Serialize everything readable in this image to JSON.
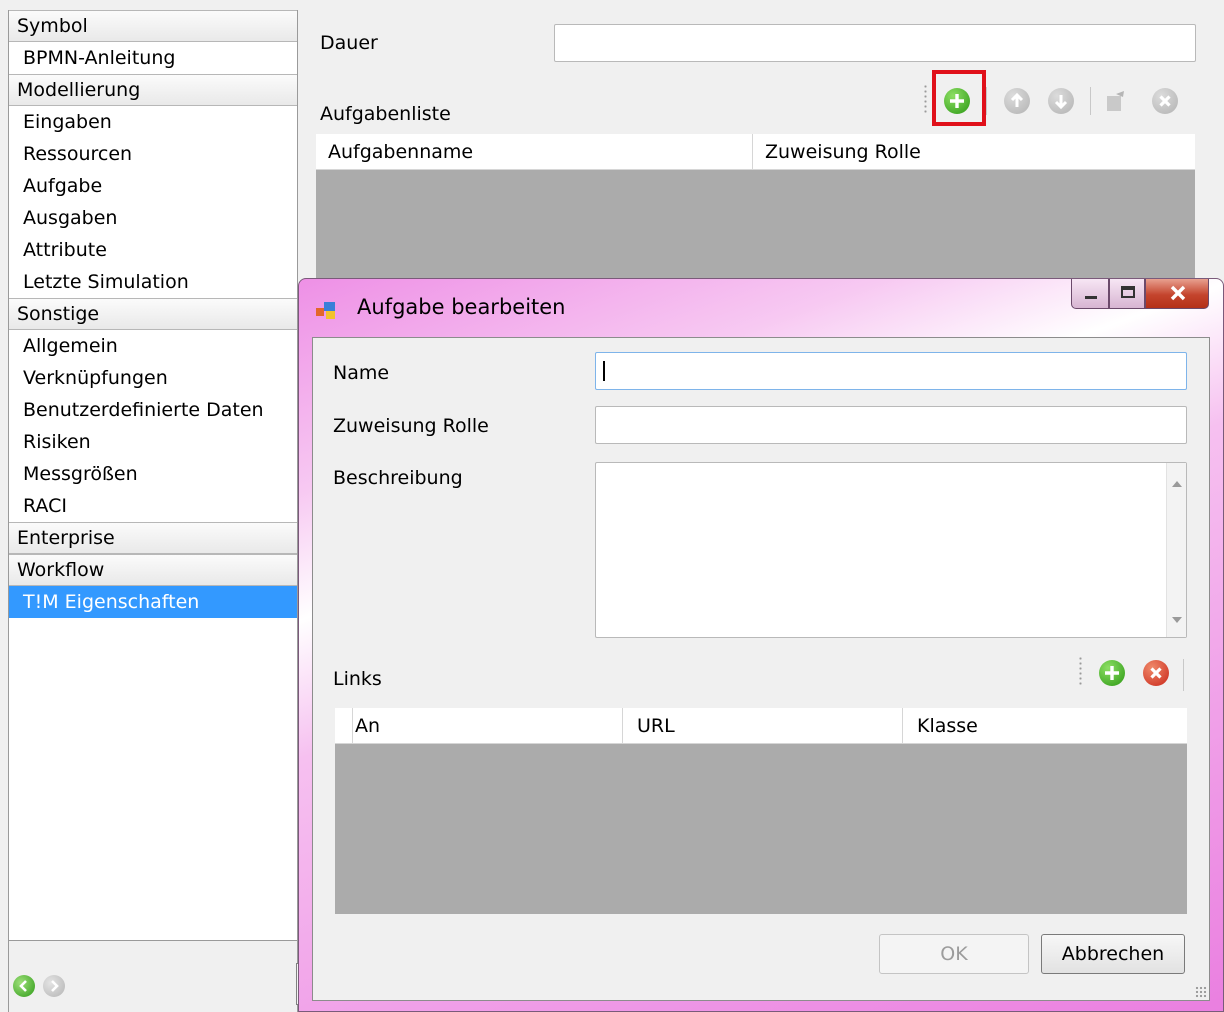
{
  "nav": {
    "items": [
      {
        "label": "Symbol",
        "type": "group"
      },
      {
        "label": "BPMN-Anleitung",
        "type": "item"
      },
      {
        "label": "Modellierung",
        "type": "group"
      },
      {
        "label": "Eingaben",
        "type": "item"
      },
      {
        "label": "Ressourcen",
        "type": "item"
      },
      {
        "label": "Aufgabe",
        "type": "item"
      },
      {
        "label": "Ausgaben",
        "type": "item"
      },
      {
        "label": "Attribute",
        "type": "item"
      },
      {
        "label": "Letzte Simulation",
        "type": "item"
      },
      {
        "label": "Sonstige",
        "type": "group"
      },
      {
        "label": "Allgemein",
        "type": "item"
      },
      {
        "label": "Verknüpfungen",
        "type": "item"
      },
      {
        "label": "Benutzerdefinierte Daten",
        "type": "item"
      },
      {
        "label": "Risiken",
        "type": "item"
      },
      {
        "label": "Messgrößen",
        "type": "item"
      },
      {
        "label": "RACI",
        "type": "item"
      },
      {
        "label": "Enterprise",
        "type": "group"
      },
      {
        "label": "Workflow",
        "type": "group"
      },
      {
        "label": "T!M Eigenschaften",
        "type": "item",
        "selected": true
      }
    ]
  },
  "props": {
    "duration_label": "Dauer",
    "duration_value": "",
    "tasklist_label": "Aufgabenliste",
    "columns": [
      "Aufgabenname",
      "Zuweisung Rolle"
    ]
  },
  "dialog": {
    "title": "Aufgabe bearbeiten",
    "name_label": "Name",
    "name_value": "",
    "role_label": "Zuweisung Rolle",
    "role_value": "",
    "description_label": "Beschreibung",
    "description_value": "",
    "links_label": "Links",
    "links_columns": [
      "An",
      "URL",
      "Klasse"
    ],
    "ok_label": "OK",
    "cancel_label": "Abbrechen"
  },
  "colors": {
    "selection": "#3399ff",
    "highlight": "#e0101a",
    "add_icon": "#2c9814",
    "delete_icon": "#c9271a"
  }
}
